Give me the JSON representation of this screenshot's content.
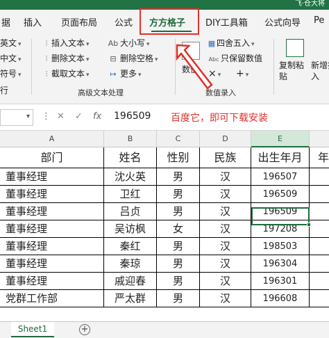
{
  "window": {
    "user": "飞·仓大将"
  },
  "tabs": [
    {
      "label": "据"
    },
    {
      "label": "插入"
    },
    {
      "label": "页面布局"
    },
    {
      "label": "公式"
    },
    {
      "label": "方方格子"
    },
    {
      "label": "DIY工具箱"
    },
    {
      "label": "公式向导"
    },
    {
      "label": "Pe"
    }
  ],
  "ribbon": {
    "left_items": [
      "英文",
      "中文",
      "符号",
      "行"
    ],
    "text_group": {
      "insert_text": "插入文本",
      "delete_text": "删除文本",
      "extract_text": "截取文本",
      "case": "大小写",
      "delete_spaces": "删除空格",
      "more": "更多",
      "label": "高级文本处理"
    },
    "number_group": {
      "round": "四舍五入",
      "keep_value": "只保留数值",
      "numeric": "数值",
      "label": "数值录入"
    },
    "copy_paste": "复制粘贴",
    "new_insert": "新增插入",
    "icon_color": "#217346"
  },
  "formula_bar": {
    "fx": "fx",
    "value": "196509",
    "annotation": "百度它，即可下载安装"
  },
  "columns": [
    "A",
    "B",
    "C",
    "D",
    "E"
  ],
  "table": {
    "headers": [
      "部门",
      "姓名",
      "性别",
      "民族",
      "出生年月",
      "年"
    ],
    "rows": [
      [
        "董事经理",
        "沈火英",
        "男",
        "汉",
        "196507"
      ],
      [
        "董事经理",
        "卫红",
        "男",
        "汉",
        "196509"
      ],
      [
        "董事经理",
        "吕贞",
        "男",
        "汉",
        "196509"
      ],
      [
        "董事经理",
        "吴访枫",
        "女",
        "汉",
        "197208"
      ],
      [
        "董事经理",
        "秦红",
        "男",
        "汉",
        "198503"
      ],
      [
        "董事经理",
        "秦琼",
        "男",
        "汉",
        "196304"
      ],
      [
        "董事经理",
        "戚迎春",
        "男",
        "汉",
        "196301"
      ],
      [
        "党群工作部",
        "严太群",
        "男",
        "汉",
        "196608"
      ]
    ]
  },
  "sheets": [
    {
      "name": "Sheet1"
    }
  ],
  "add_sheet": "+"
}
